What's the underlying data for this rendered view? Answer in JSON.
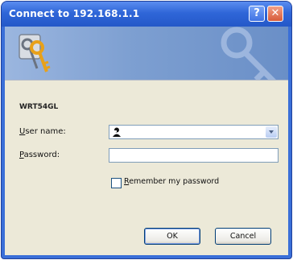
{
  "window": {
    "title": "Connect to 192.168.1.1",
    "help_label": "?",
    "close_label": "✕"
  },
  "icons": {
    "banner": "keys-icon",
    "user_dropdown": "chevron-down-icon",
    "user_avatar": "user-icon"
  },
  "form": {
    "device_name": "WRT54GL",
    "username_label_hotkey": "U",
    "username_label_rest": "ser name:",
    "username_value": "",
    "password_label_hotkey": "P",
    "password_label_rest": "assword:",
    "password_value": "",
    "remember_hotkey": "R",
    "remember_rest": "emember my password",
    "remember_checked": false
  },
  "buttons": {
    "ok_label": "OK",
    "cancel_label": "Cancel"
  },
  "colors": {
    "titlebar": "#2f66d8",
    "client_bg": "#ece9d8",
    "banner": "#7d9fd1"
  }
}
